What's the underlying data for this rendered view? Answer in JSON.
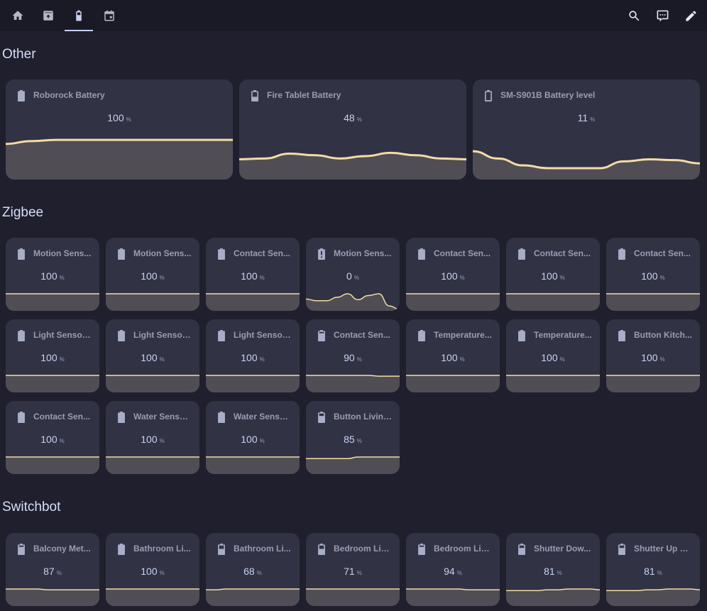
{
  "topbar": {
    "tabs": [
      {
        "name": "home",
        "icon": "home-icon",
        "active": false
      },
      {
        "name": "robot",
        "icon": "robot-vacuum-icon",
        "active": false
      },
      {
        "name": "battery",
        "icon": "battery-icon",
        "active": true
      },
      {
        "name": "calendar",
        "icon": "calendar-icon",
        "active": false
      }
    ],
    "actions": [
      {
        "name": "search",
        "icon": "search-icon"
      },
      {
        "name": "assist",
        "icon": "chat-icon"
      },
      {
        "name": "edit",
        "icon": "pencil-icon"
      }
    ]
  },
  "colors": {
    "background": "#1f1f2e",
    "card": "#313244",
    "graph_line": "#f5dba6",
    "graph_fill": "#504e54",
    "text_value": "#c8d2f0",
    "text_name": "#9a9cb3",
    "section_title": "#d6ddf7"
  },
  "sections": [
    {
      "title": "Other",
      "cards": [
        {
          "name": "Roborock Battery",
          "value": "100",
          "unit": "%",
          "icon": "battery-full-icon",
          "history": [
            88,
            95,
            98,
            98,
            98,
            98,
            98,
            98,
            98,
            98
          ]
        },
        {
          "name": "Fire Tablet Battery",
          "value": "48",
          "unit": "%",
          "icon": "battery-50-icon",
          "history": [
            50,
            52,
            64,
            60,
            52,
            58,
            66,
            60,
            52,
            50
          ]
        },
        {
          "name": "SM-S901B Battery level",
          "value": "11",
          "unit": "%",
          "icon": "battery-10-icon",
          "history": [
            70,
            52,
            35,
            28,
            28,
            28,
            45,
            50,
            48,
            40
          ]
        }
      ]
    },
    {
      "title": "Zigbee",
      "cards": [
        {
          "name": "Motion Sens...",
          "value": "100",
          "unit": "%",
          "icon": "battery-full-icon",
          "history": [
            100,
            100,
            100,
            100,
            100,
            100,
            100,
            100,
            100,
            100
          ]
        },
        {
          "name": "Motion Sens...",
          "value": "100",
          "unit": "%",
          "icon": "battery-full-icon",
          "history": [
            100,
            100,
            100,
            100,
            100,
            100,
            100,
            100,
            100,
            100
          ]
        },
        {
          "name": "Contact Sen...",
          "value": "100",
          "unit": "%",
          "icon": "battery-full-icon",
          "history": [
            100,
            100,
            100,
            100,
            100,
            100,
            100,
            100,
            100,
            100
          ]
        },
        {
          "name": "Motion Sens...",
          "value": "0",
          "unit": "%",
          "icon": "battery-alert-icon",
          "history": [
            30,
            25,
            25,
            35,
            45,
            28,
            40,
            45,
            10,
            0
          ]
        },
        {
          "name": "Contact Sen...",
          "value": "100",
          "unit": "%",
          "icon": "battery-full-icon",
          "history": [
            100,
            100,
            100,
            100,
            100,
            100,
            100,
            100,
            100,
            100
          ]
        },
        {
          "name": "Contact Sen...",
          "value": "100",
          "unit": "%",
          "icon": "battery-full-icon",
          "history": [
            100,
            100,
            100,
            100,
            100,
            100,
            100,
            100,
            100,
            100
          ]
        },
        {
          "name": "Contact Sen...",
          "value": "100",
          "unit": "%",
          "icon": "battery-full-icon",
          "history": [
            100,
            100,
            100,
            100,
            100,
            100,
            100,
            100,
            100,
            100
          ]
        },
        {
          "name": "Light Sensor ...",
          "value": "100",
          "unit": "%",
          "icon": "battery-full-icon",
          "history": [
            100,
            100,
            100,
            100,
            100,
            100,
            100,
            100,
            100,
            100
          ]
        },
        {
          "name": "Light Sensor ...",
          "value": "100",
          "unit": "%",
          "icon": "battery-full-icon",
          "history": [
            100,
            100,
            100,
            100,
            100,
            100,
            100,
            100,
            100,
            100
          ]
        },
        {
          "name": "Light Sensor ...",
          "value": "100",
          "unit": "%",
          "icon": "battery-full-icon",
          "history": [
            100,
            100,
            100,
            100,
            100,
            100,
            100,
            100,
            100,
            100
          ]
        },
        {
          "name": "Contact Sen...",
          "value": "90",
          "unit": "%",
          "icon": "battery-90-icon",
          "history": [
            91,
            91,
            91,
            91,
            91,
            91,
            91,
            90,
            90,
            90
          ]
        },
        {
          "name": "Temperature...",
          "value": "100",
          "unit": "%",
          "icon": "battery-full-icon",
          "history": [
            100,
            100,
            100,
            100,
            100,
            100,
            100,
            100,
            100,
            100
          ]
        },
        {
          "name": "Temperature...",
          "value": "100",
          "unit": "%",
          "icon": "battery-full-icon",
          "history": [
            100,
            100,
            100,
            100,
            100,
            100,
            100,
            100,
            100,
            100
          ]
        },
        {
          "name": "Button Kitch...",
          "value": "100",
          "unit": "%",
          "icon": "battery-full-icon",
          "history": [
            100,
            100,
            100,
            100,
            100,
            100,
            100,
            100,
            100,
            100
          ]
        },
        {
          "name": "Contact Sen...",
          "value": "100",
          "unit": "%",
          "icon": "battery-full-icon",
          "history": [
            100,
            100,
            100,
            100,
            100,
            100,
            100,
            100,
            100,
            100
          ]
        },
        {
          "name": "Water Senso...",
          "value": "100",
          "unit": "%",
          "icon": "battery-full-icon",
          "history": [
            100,
            100,
            100,
            100,
            100,
            100,
            100,
            100,
            100,
            100
          ]
        },
        {
          "name": "Water Senso...",
          "value": "100",
          "unit": "%",
          "icon": "battery-full-icon",
          "history": [
            100,
            100,
            100,
            100,
            100,
            100,
            100,
            100,
            100,
            100
          ]
        },
        {
          "name": "Button Living...",
          "value": "85",
          "unit": "%",
          "icon": "battery-80-icon",
          "history": [
            84,
            84,
            84,
            84,
            84,
            86,
            86,
            86,
            86,
            86
          ]
        }
      ]
    },
    {
      "title": "Switchbot",
      "cards": [
        {
          "name": "Balcony Met...",
          "value": "87",
          "unit": "%",
          "icon": "battery-90-icon",
          "history": [
            88,
            88,
            88,
            88,
            87,
            87,
            87,
            87,
            87,
            87
          ]
        },
        {
          "name": "Bathroom Li...",
          "value": "100",
          "unit": "%",
          "icon": "battery-full-icon",
          "history": [
            100,
            100,
            100,
            100,
            100,
            100,
            100,
            100,
            100,
            100
          ]
        },
        {
          "name": "Bathroom Li...",
          "value": "68",
          "unit": "%",
          "icon": "battery-70-icon",
          "history": [
            67,
            67,
            68,
            68,
            68,
            68,
            68,
            68,
            68,
            68
          ]
        },
        {
          "name": "Bedroom Lig...",
          "value": "71",
          "unit": "%",
          "icon": "battery-70-icon",
          "history": [
            71,
            71,
            71,
            71,
            71,
            71,
            71,
            71,
            71,
            71
          ]
        },
        {
          "name": "Bedroom Lig...",
          "value": "94",
          "unit": "%",
          "icon": "battery-90-icon",
          "history": [
            95,
            95,
            95,
            95,
            95,
            95,
            94,
            94,
            94,
            94
          ]
        },
        {
          "name": "Shutter Dow...",
          "value": "81",
          "unit": "%",
          "icon": "battery-80-icon",
          "history": [
            80,
            80,
            80,
            80,
            81,
            81,
            82,
            82,
            82,
            81
          ]
        },
        {
          "name": "Shutter Up B...",
          "value": "81",
          "unit": "%",
          "icon": "battery-80-icon",
          "history": [
            80,
            80,
            80,
            80,
            81,
            81,
            82,
            82,
            82,
            81
          ]
        }
      ]
    }
  ]
}
